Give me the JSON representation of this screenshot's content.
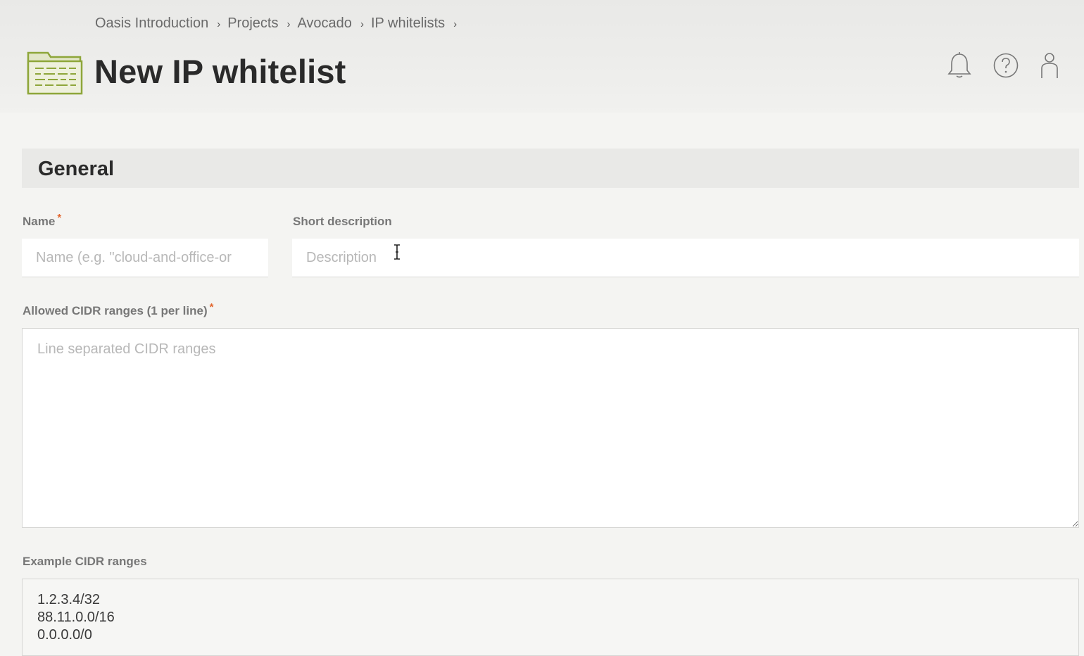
{
  "breadcrumb": {
    "items": [
      {
        "label": "Oasis Introduction"
      },
      {
        "label": "Projects"
      },
      {
        "label": "Avocado"
      },
      {
        "label": "IP whitelists"
      }
    ],
    "separator": "›"
  },
  "page": {
    "title": "New IP whitelist",
    "icon": "folder-list-icon",
    "accent_color": "#8ea63a"
  },
  "header_actions": [
    {
      "name": "notifications",
      "icon": "bell-icon"
    },
    {
      "name": "help",
      "icon": "help-circle-icon"
    },
    {
      "name": "account",
      "icon": "user-icon"
    }
  ],
  "section": {
    "title": "General"
  },
  "form": {
    "name": {
      "label": "Name",
      "required_marker": "*",
      "placeholder": "Name (e.g. \"cloud-and-office-or",
      "value": ""
    },
    "description": {
      "label": "Short description",
      "placeholder": "Description",
      "value": ""
    },
    "cidr": {
      "label": "Allowed CIDR ranges (1 per line)",
      "required_marker": "*",
      "placeholder": "Line separated CIDR ranges",
      "value": ""
    },
    "examples": {
      "label": "Example CIDR ranges",
      "lines": [
        "1.2.3.4/32",
        "88.11.0.0/16",
        "0.0.0.0/0"
      ]
    }
  },
  "colors": {
    "required": "#e2672f",
    "label": "#777777",
    "placeholder": "#b8b8b8"
  }
}
